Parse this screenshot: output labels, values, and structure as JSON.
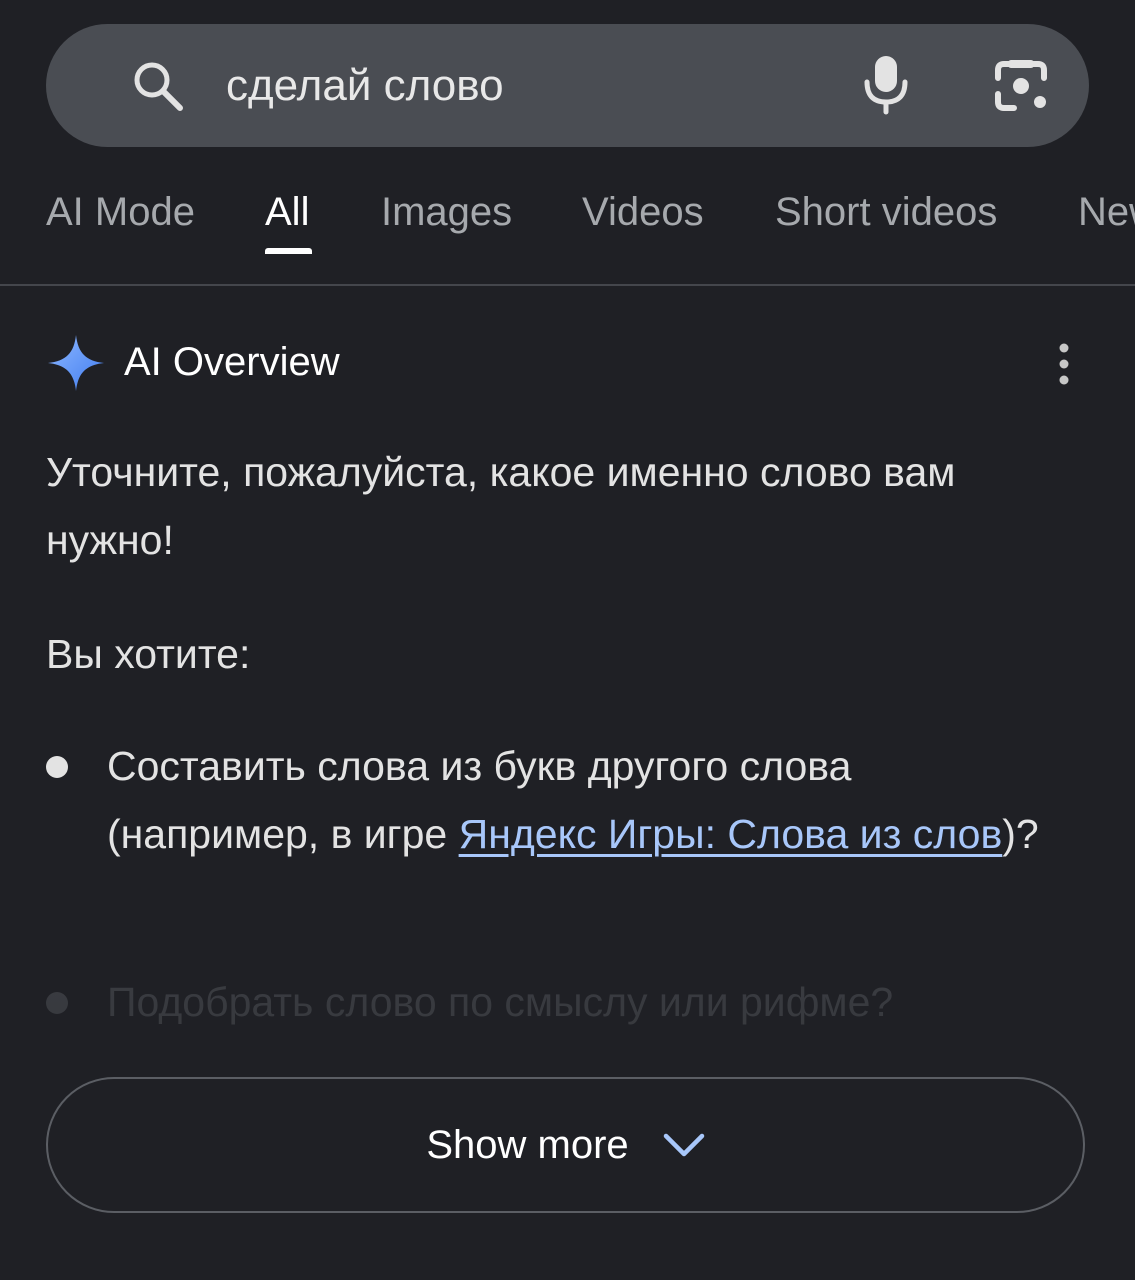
{
  "search": {
    "query": "сделай слово"
  },
  "tabs": [
    {
      "label": "AI Mode",
      "active": false
    },
    {
      "label": "All",
      "active": true
    },
    {
      "label": "Images",
      "active": false
    },
    {
      "label": "Videos",
      "active": false
    },
    {
      "label": "Short videos",
      "active": false
    },
    {
      "label": "News",
      "active": false
    }
  ],
  "ai_overview": {
    "title": "AI Overview",
    "intro": "Уточните, пожалуйста, какое именно слово вам нужно!",
    "question": "Вы хотите:",
    "bullets": [
      {
        "before": "Составить слова из букв другого слова (например, в игре ",
        "link": "Яндекс Игры: Слова из слов",
        "after": ")?"
      },
      {
        "text": "Подобрать слово по смыслу или рифме?"
      }
    ]
  },
  "show_more": {
    "label": "Show more"
  },
  "colors": {
    "background": "#1f2025",
    "search_bg": "#4a4d53",
    "link": "#a8c7fa",
    "sparkle": "#6ea4f9"
  },
  "icons": [
    "search-icon",
    "mic-icon",
    "lens-icon",
    "sparkle-icon",
    "more-vert-icon",
    "chevron-down-icon"
  ]
}
